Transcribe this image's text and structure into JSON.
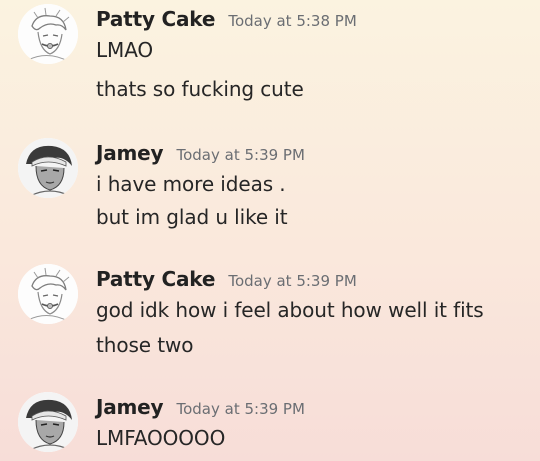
{
  "messages": [
    {
      "author": "Patty Cake",
      "time": "Today at 5:38 PM",
      "lines": [
        "LMAO",
        "thats so fucking cute"
      ]
    },
    {
      "author": "Jamey",
      "time": "Today at 5:39 PM",
      "lines": [
        "i have more ideas .",
        "but im glad u like it"
      ]
    },
    {
      "author": "Patty Cake",
      "time": "Today at 5:39 PM",
      "lines": [
        "god idk how i feel about how well it fits",
        "those two"
      ]
    },
    {
      "author": "Jamey",
      "time": "Today at 5:39 PM",
      "lines": [
        "LMFAOOOOO"
      ]
    }
  ]
}
